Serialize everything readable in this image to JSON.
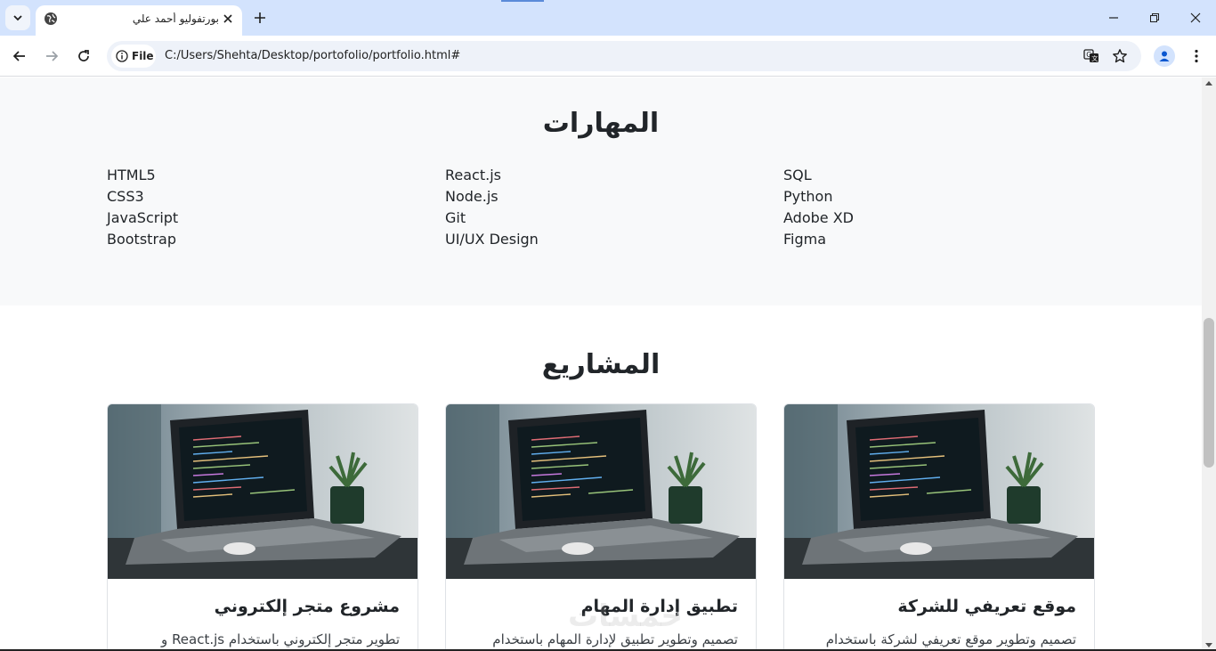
{
  "browser": {
    "tab_title": "بورتفوليو أحمد علي",
    "file_chip": "File",
    "url": "C:/Users/Shehta/Desktop/portofolio/portfolio.html#"
  },
  "skills": {
    "title": "المهارات",
    "columns": [
      [
        "HTML5",
        "CSS3",
        "JavaScript",
        "Bootstrap"
      ],
      [
        "React.js",
        "Node.js",
        "Git",
        "UI/UX Design"
      ],
      [
        "SQL",
        "Python",
        "Adobe XD",
        "Figma"
      ]
    ]
  },
  "projects": {
    "title": "المشاريع",
    "cards": [
      {
        "title": "موقع تعريفي للشركة",
        "text": "تصميم وتطوير موقع تعريفي لشركة باستخدام"
      },
      {
        "title": "تطبيق إدارة المهام",
        "text": "تصميم وتطوير تطبيق لإدارة المهام باستخدام"
      },
      {
        "title": "مشروع متجر إلكتروني",
        "text": "تطوير متجر إلكتروني باستخدام React.js و"
      }
    ]
  },
  "watermark": "خمسات",
  "colors": {
    "tabbar": "#d3e3fd",
    "skills_bg": "#f8f9fa",
    "text": "#212529"
  }
}
